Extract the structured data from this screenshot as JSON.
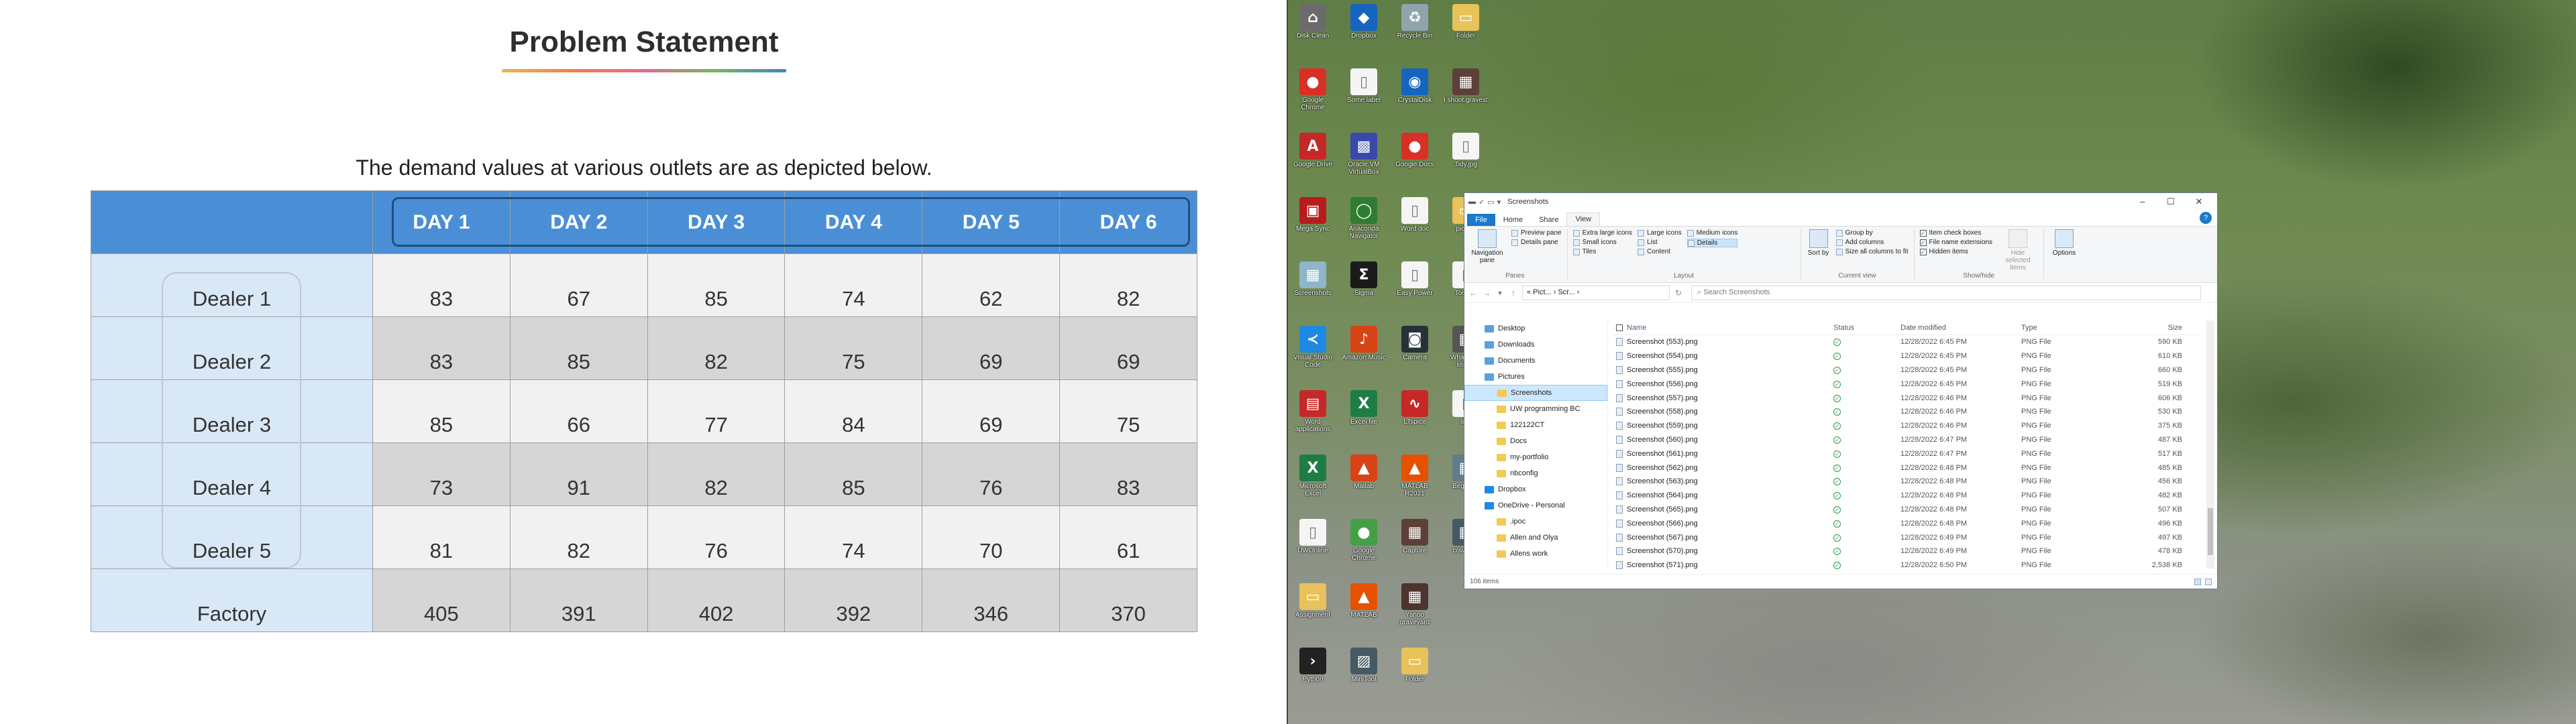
{
  "slide": {
    "title": "Problem Statement",
    "subtitle": "The demand values at various outlets are as depicted below.",
    "table": {
      "headers": [
        "DAY 1",
        "DAY 2",
        "DAY 3",
        "DAY 4",
        "DAY 5",
        "DAY 6"
      ],
      "rows": [
        {
          "label": "Dealer 1",
          "values": [
            "83",
            "67",
            "85",
            "74",
            "62",
            "82"
          ]
        },
        {
          "label": "Dealer 2",
          "values": [
            "83",
            "85",
            "82",
            "75",
            "69",
            "69"
          ]
        },
        {
          "label": "Dealer 3",
          "values": [
            "85",
            "66",
            "77",
            "84",
            "69",
            "75"
          ]
        },
        {
          "label": "Dealer 4",
          "values": [
            "73",
            "91",
            "82",
            "85",
            "76",
            "83"
          ]
        },
        {
          "label": "Dealer 5",
          "values": [
            "81",
            "82",
            "76",
            "74",
            "70",
            "61"
          ]
        },
        {
          "label": "Factory",
          "values": [
            "405",
            "391",
            "402",
            "392",
            "346",
            "370"
          ]
        }
      ]
    },
    "colors": {
      "header_blue": "#4a8fd6",
      "row_head_blue": "#d9e8f6",
      "header_box": "#1f4f7d"
    }
  },
  "desktop": {
    "icons": [
      {
        "label": "Disk Clean",
        "icon": "app-icon",
        "color": "#6b6b6b",
        "glyph": "⌂"
      },
      {
        "label": "Google Chrome",
        "icon": "chrome-icon",
        "color": "#d93025",
        "glyph": "●"
      },
      {
        "label": "Google Drive",
        "icon": "pdf-icon",
        "color": "#c62828",
        "glyph": "A"
      },
      {
        "label": "Mega Sync",
        "icon": "app-icon",
        "color": "#b71c1c",
        "glyph": "▣"
      },
      {
        "label": "Screenshots",
        "icon": "image-icon",
        "color": "#8fb5c9",
        "glyph": "▦"
      },
      {
        "label": "Visual Studio Code",
        "icon": "vscode-icon",
        "color": "#1e88e5",
        "glyph": "≺"
      },
      {
        "label": "Word applications",
        "icon": "word-icon",
        "color": "#c62828",
        "glyph": "▤"
      },
      {
        "label": "Microsoft Excel",
        "icon": "excel-icon",
        "color": "#1e7d45",
        "glyph": "X"
      },
      {
        "label": "UWOnline",
        "icon": "file-icon",
        "color": "#f5f5f5",
        "glyph": "▯"
      },
      {
        "label": "Assignment",
        "icon": "folder-icon",
        "color": "#e8c25a",
        "glyph": "▭"
      },
      {
        "label": "Python",
        "icon": "terminal-icon",
        "color": "#222222",
        "glyph": "›"
      },
      {
        "label": "Dropbox",
        "icon": "dropbox-icon",
        "color": "#1565c0",
        "glyph": "◆"
      },
      {
        "label": "Some label",
        "icon": "file-icon",
        "color": "#f5f5f5",
        "glyph": "▯"
      },
      {
        "label": "Oracle VM VirtualBox",
        "icon": "virtualbox-icon",
        "color": "#3949ab",
        "glyph": "▩"
      },
      {
        "label": "Anaconda Navigator",
        "icon": "anaconda-icon",
        "color": "#2e7d32",
        "glyph": "◯"
      },
      {
        "label": "Sigma",
        "icon": "sigma-icon",
        "color": "#1a1a1a",
        "glyph": "Σ"
      },
      {
        "label": "Amazon Music",
        "icon": "app-icon",
        "color": "#d84315",
        "glyph": "♪"
      },
      {
        "label": "Excel file",
        "icon": "excel-icon",
        "color": "#1e7d45",
        "glyph": "X"
      },
      {
        "label": "Matlab",
        "icon": "matlab-icon",
        "color": "#d84315",
        "glyph": "▲"
      },
      {
        "label": "Google Chrome",
        "icon": "chrome-icon",
        "color": "#43a047",
        "glyph": "●"
      },
      {
        "label": "MATLAB",
        "icon": "matlab-icon",
        "color": "#e65100",
        "glyph": "▲"
      },
      {
        "label": "MiniTool",
        "icon": "app-icon",
        "color": "#455a64",
        "glyph": "▨"
      },
      {
        "label": "Recycle Bin",
        "icon": "recycle-bin-icon",
        "color": "#90a4ae",
        "glyph": "♻"
      },
      {
        "label": "CrystalDisk",
        "icon": "app-icon",
        "color": "#1565c0",
        "glyph": "◉"
      },
      {
        "label": "Google Docs",
        "icon": "chrome-icon",
        "color": "#d93025",
        "glyph": "●"
      },
      {
        "label": "Word doc",
        "icon": "file-icon",
        "color": "#f5f5f5",
        "glyph": "▯"
      },
      {
        "label": "Easy Power",
        "icon": "file-icon",
        "color": "#f5f5f5",
        "glyph": "▯"
      },
      {
        "label": "Camera",
        "icon": "camera-icon",
        "color": "#263238",
        "glyph": "◙"
      },
      {
        "label": "LTspice",
        "icon": "app-icon",
        "color": "#c62828",
        "glyph": "∿"
      },
      {
        "label": "MATLAB R2021",
        "icon": "matlab-icon",
        "color": "#e65100",
        "glyph": "▲"
      },
      {
        "label": "Capture",
        "icon": "image-icon",
        "color": "#5d4037",
        "glyph": "▦"
      },
      {
        "label": "Yahoo graveyard",
        "icon": "image-icon",
        "color": "#4e342e",
        "glyph": "▦"
      },
      {
        "label": "Folder",
        "icon": "folder-icon",
        "color": "#e8c25a",
        "glyph": "▭"
      },
      {
        "label": "Folder",
        "icon": "folder-icon",
        "color": "#e8c25a",
        "glyph": "▭"
      },
      {
        "label": "I.shoot.gravestone",
        "icon": "image-icon",
        "color": "#5d4037",
        "glyph": "▦"
      },
      {
        "label": "Tidy.jpg",
        "icon": "file-icon",
        "color": "#f5f5f5",
        "glyph": "▯"
      },
      {
        "label": "pic.jpg",
        "icon": "folder-icon",
        "color": "#e8c25a",
        "glyph": "▭"
      },
      {
        "label": "Toolbar",
        "icon": "file-icon",
        "color": "#f5f5f5",
        "glyph": "▯"
      },
      {
        "label": "WhatsApp image",
        "icon": "image-icon",
        "color": "#555555",
        "glyph": "▦"
      },
      {
        "label": "text",
        "icon": "file-icon",
        "color": "#f5f5f5",
        "glyph": "▯"
      },
      {
        "label": "Beginner",
        "icon": "image-icon",
        "color": "#607d8b",
        "glyph": "▦"
      },
      {
        "label": "cow.jpeg",
        "icon": "image-icon",
        "color": "#455a64",
        "glyph": "▦"
      }
    ]
  },
  "explorer": {
    "title": "Screenshots",
    "tabs": {
      "file": "File",
      "home": "Home",
      "share": "Share",
      "view": "View"
    },
    "ribbon": {
      "panes": {
        "navigation_pane": "Navigation pane",
        "preview_pane": "Preview pane",
        "details_pane": "Details pane",
        "label": "Panes"
      },
      "layout": {
        "extra_large": "Extra large icons",
        "large": "Large icons",
        "medium": "Medium icons",
        "small": "Small icons",
        "list": "List",
        "details": "Details",
        "tiles": "Tiles",
        "content": "Content",
        "label": "Layout"
      },
      "current_view": {
        "sort_by": "Sort by",
        "group_by": "Group by",
        "add_columns": "Add columns",
        "size_all": "Size all columns to fit",
        "label": "Current view"
      },
      "show_hide": {
        "item_check_boxes": "Item check boxes",
        "file_name_extensions": "File name extensions",
        "hidden_items": "Hidden items",
        "hide_selected": "Hide selected items",
        "label": "Show/hide"
      },
      "options": "Options"
    },
    "address": {
      "path": "« Pict... › Scr... ›",
      "search_placeholder": "Search Screenshots"
    },
    "nav_items": [
      {
        "label": "Desktop",
        "icon": "desktop-icon",
        "sub": false
      },
      {
        "label": "Downloads",
        "icon": "download-icon",
        "sub": false
      },
      {
        "label": "Documents",
        "icon": "documents-icon",
        "sub": false
      },
      {
        "label": "Pictures",
        "icon": "pictures-icon",
        "sub": false
      },
      {
        "label": "Screenshots",
        "icon": "folder-icon",
        "sub": true
      },
      {
        "label": "UW programming BC",
        "icon": "folder-icon",
        "sub": true
      },
      {
        "label": "122122CT",
        "icon": "folder-icon",
        "sub": true
      },
      {
        "label": "Docs",
        "icon": "folder-icon",
        "sub": true
      },
      {
        "label": "my-portfolio",
        "icon": "folder-icon",
        "sub": true
      },
      {
        "label": "nbconfig",
        "icon": "folder-icon",
        "sub": true
      },
      {
        "label": "Dropbox",
        "icon": "dropbox-icon",
        "sub": false
      },
      {
        "label": "OneDrive - Personal",
        "icon": "onedrive-icon",
        "sub": false
      },
      {
        "label": ".ipoc",
        "icon": "folder-icon",
        "sub": true
      },
      {
        "label": "Allen and Olya",
        "icon": "folder-icon",
        "sub": true
      },
      {
        "label": "Allens work",
        "icon": "folder-icon",
        "sub": true
      }
    ],
    "columns": {
      "name": "Name",
      "status": "Status",
      "date": "Date modified",
      "type": "Type",
      "size": "Size"
    },
    "files": [
      {
        "name": "Screenshot (553).png",
        "date": "12/28/2022 6:45 PM",
        "type": "PNG File",
        "size": "590 KB"
      },
      {
        "name": "Screenshot (554).png",
        "date": "12/28/2022 6:45 PM",
        "type": "PNG File",
        "size": "610 KB"
      },
      {
        "name": "Screenshot (555).png",
        "date": "12/28/2022 6:45 PM",
        "type": "PNG File",
        "size": "660 KB"
      },
      {
        "name": "Screenshot (556).png",
        "date": "12/28/2022 6:45 PM",
        "type": "PNG File",
        "size": "519 KB"
      },
      {
        "name": "Screenshot (557).png",
        "date": "12/28/2022 6:46 PM",
        "type": "PNG File",
        "size": "606 KB"
      },
      {
        "name": "Screenshot (558).png",
        "date": "12/28/2022 6:46 PM",
        "type": "PNG File",
        "size": "530 KB"
      },
      {
        "name": "Screenshot (559).png",
        "date": "12/28/2022 6:46 PM",
        "type": "PNG File",
        "size": "375 KB"
      },
      {
        "name": "Screenshot (560).png",
        "date": "12/28/2022 6:47 PM",
        "type": "PNG File",
        "size": "487 KB"
      },
      {
        "name": "Screenshot (561).png",
        "date": "12/28/2022 6:47 PM",
        "type": "PNG File",
        "size": "517 KB"
      },
      {
        "name": "Screenshot (562).png",
        "date": "12/28/2022 6:48 PM",
        "type": "PNG File",
        "size": "485 KB"
      },
      {
        "name": "Screenshot (563).png",
        "date": "12/28/2022 6:48 PM",
        "type": "PNG File",
        "size": "456 KB"
      },
      {
        "name": "Screenshot (564).png",
        "date": "12/28/2022 6:48 PM",
        "type": "PNG File",
        "size": "482 KB"
      },
      {
        "name": "Screenshot (565).png",
        "date": "12/28/2022 6:48 PM",
        "type": "PNG File",
        "size": "507 KB"
      },
      {
        "name": "Screenshot (566).png",
        "date": "12/28/2022 6:48 PM",
        "type": "PNG File",
        "size": "496 KB"
      },
      {
        "name": "Screenshot (567).png",
        "date": "12/28/2022 6:49 PM",
        "type": "PNG File",
        "size": "497 KB"
      },
      {
        "name": "Screenshot (570).png",
        "date": "12/28/2022 6:49 PM",
        "type": "PNG File",
        "size": "478 KB"
      },
      {
        "name": "Screenshot (571).png",
        "date": "12/28/2022 6:50 PM",
        "type": "PNG File",
        "size": "2,538 KB"
      }
    ],
    "status": "106 items"
  }
}
